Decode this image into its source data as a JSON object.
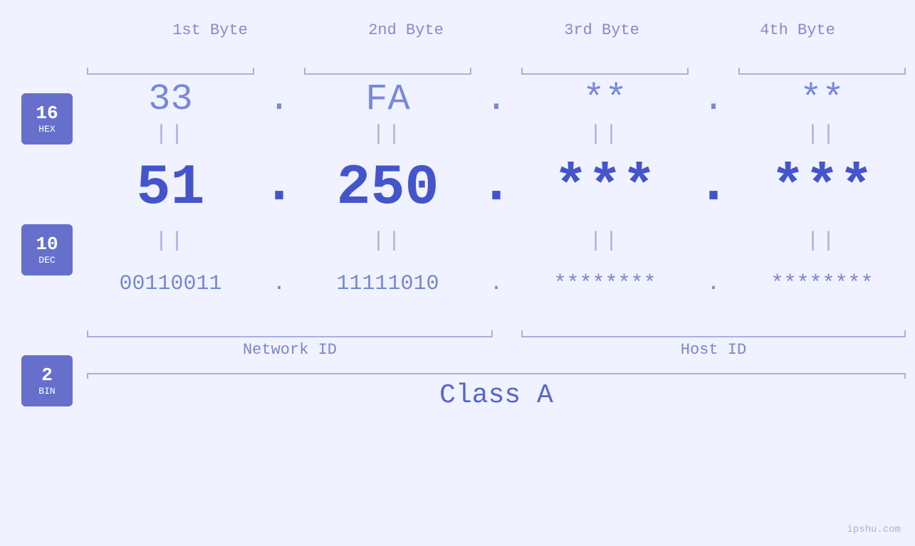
{
  "bytes": {
    "labels": [
      "1st Byte",
      "2nd Byte",
      "3rd Byte",
      "4th Byte"
    ]
  },
  "bases": [
    {
      "num": "16",
      "name": "HEX"
    },
    {
      "num": "10",
      "name": "DEC"
    },
    {
      "num": "2",
      "name": "BIN"
    }
  ],
  "values": {
    "hex": [
      "33",
      "FA",
      "**",
      "**"
    ],
    "dec": [
      "51",
      "250",
      "***",
      "***"
    ],
    "bin": [
      "00110011",
      "11111010",
      "********",
      "********"
    ]
  },
  "separators": {
    "hex_dot": ".",
    "dec_dot": ".",
    "bin_dot": "."
  },
  "equals": "||",
  "labels": {
    "network_id": "Network ID",
    "host_id": "Host ID",
    "class": "Class A"
  },
  "watermark": "ipshu.com"
}
